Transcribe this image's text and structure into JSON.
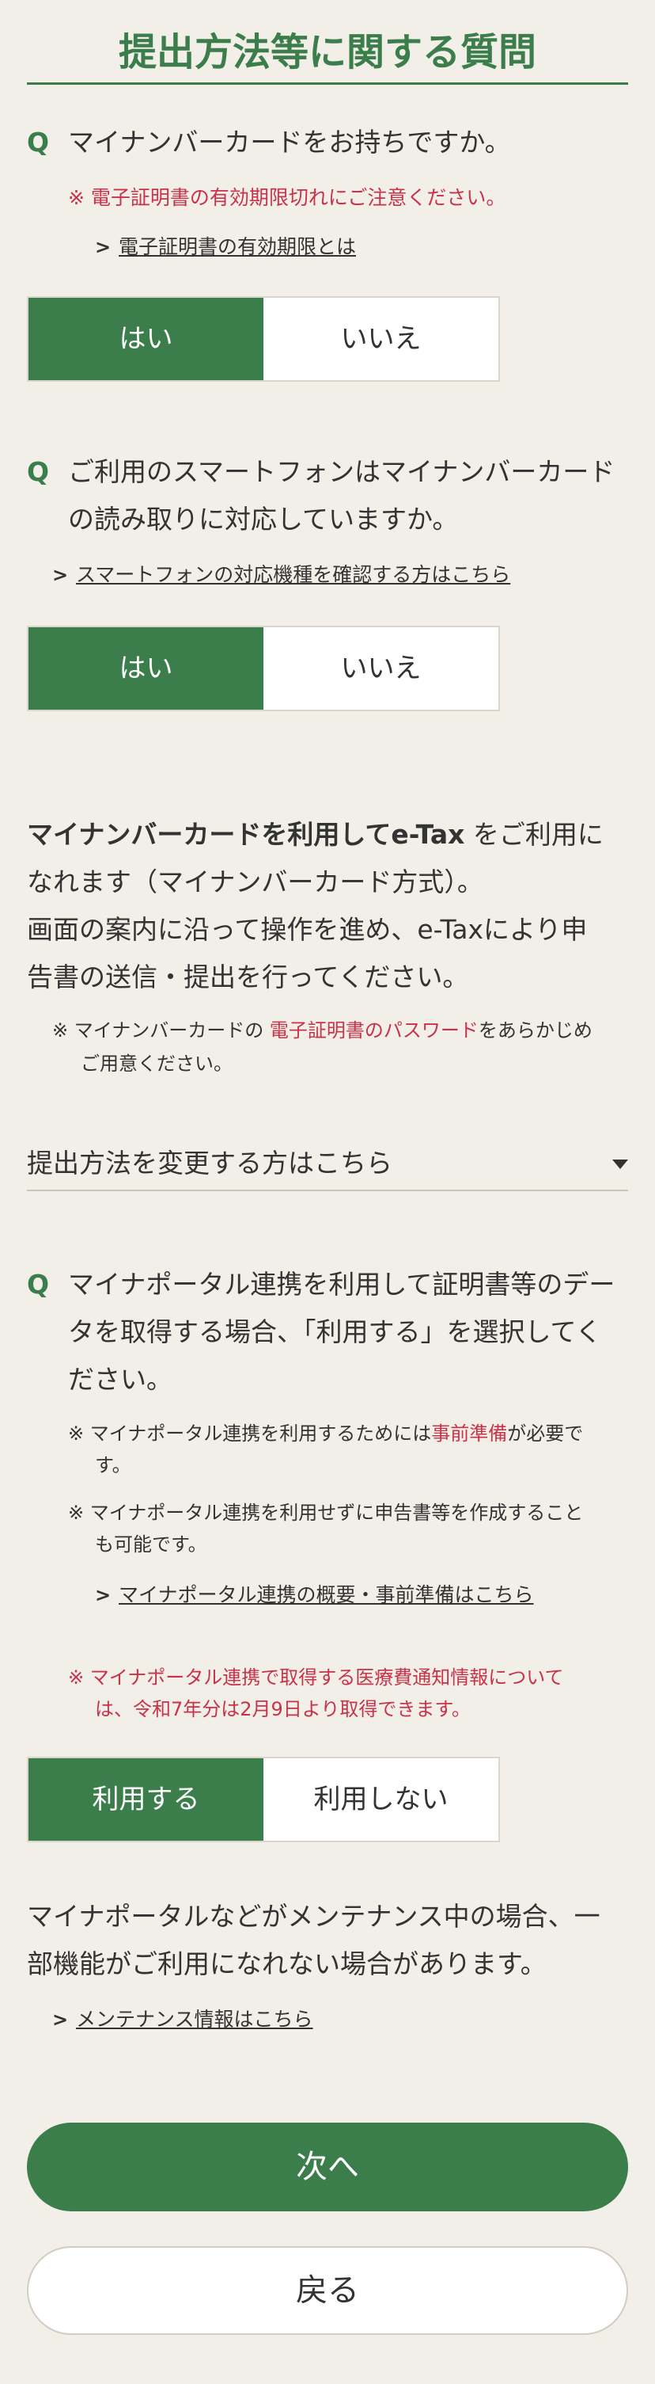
{
  "page": {
    "title": "提出方法等に関する質問"
  },
  "q1": {
    "mark": "Q",
    "text": "マイナンバーカードをお持ちですか。",
    "note_prefix": "※",
    "note": "電子証明書の有効期限切れにご注意ください。",
    "link": "電子証明書の有効期限とは",
    "options": [
      "はい",
      "いいえ"
    ],
    "selected": "はい"
  },
  "q2": {
    "mark": "Q",
    "text_line1": "ご利用のスマートフォンはマイナンバーカード",
    "text_line2": "の読み取りに対応していますか。",
    "link": "スマートフォンの対応機種を確認する方はこちら",
    "options": [
      "はい",
      "いいえ"
    ],
    "selected": "はい"
  },
  "result": {
    "bold": "マイナンバーカードを利用してe-Tax",
    "line1_rest": " をご利用に",
    "line2": "なれます（マイナンバーカード方式）。",
    "line3": "画面の案内に沿って操作を進め、e-Taxにより申",
    "line4": "告書の送信・提出を行ってください。",
    "note_prefix": "※",
    "note_a": "マイナンバーカードの",
    "note_red": "電子証明書のパスワード",
    "note_b": "をあらかじめ",
    "note_line2": "ご用意ください。"
  },
  "dropdown": {
    "label": "提出方法を変更する方はこちら",
    "icon": "caret-down-icon"
  },
  "q3": {
    "mark": "Q",
    "text_line1": "マイナポータル連携を利用して証明書等のデー",
    "text_line2": "タを取得する場合、「利用する」を選択してく",
    "text_line3": "ださい。",
    "note1_prefix": "※",
    "note1_a": "マイナポータル連携を利用するためには",
    "note1_red": "事前準備",
    "note1_b": "が必要で",
    "note1_line2": "す。",
    "note2_prefix": "※",
    "note2_line1": "マイナポータル連携を利用せずに申告書等を作成すること",
    "note2_line2": "も可能です。",
    "link": "マイナポータル連携の概要・事前準備はこちら",
    "red_note_prefix": "※",
    "red_note_line1": "マイナポータル連携で取得する医療費通知情報について",
    "red_note_line2": "は、令和7年分は2月9日より取得できます。",
    "options": [
      "利用する",
      "利用しない"
    ],
    "selected": "利用する"
  },
  "maintenance": {
    "line1": "マイナポータルなどがメンテナンス中の場合、一",
    "line2": "部機能がご利用になれない場合があります。",
    "link": "メンテナンス情報はこちら"
  },
  "actions": {
    "next": "次へ",
    "back": "戻る"
  },
  "colors": {
    "brand_green": "#3b7d4b",
    "alert_red": "#c8334a",
    "background": "#f1efe7"
  }
}
